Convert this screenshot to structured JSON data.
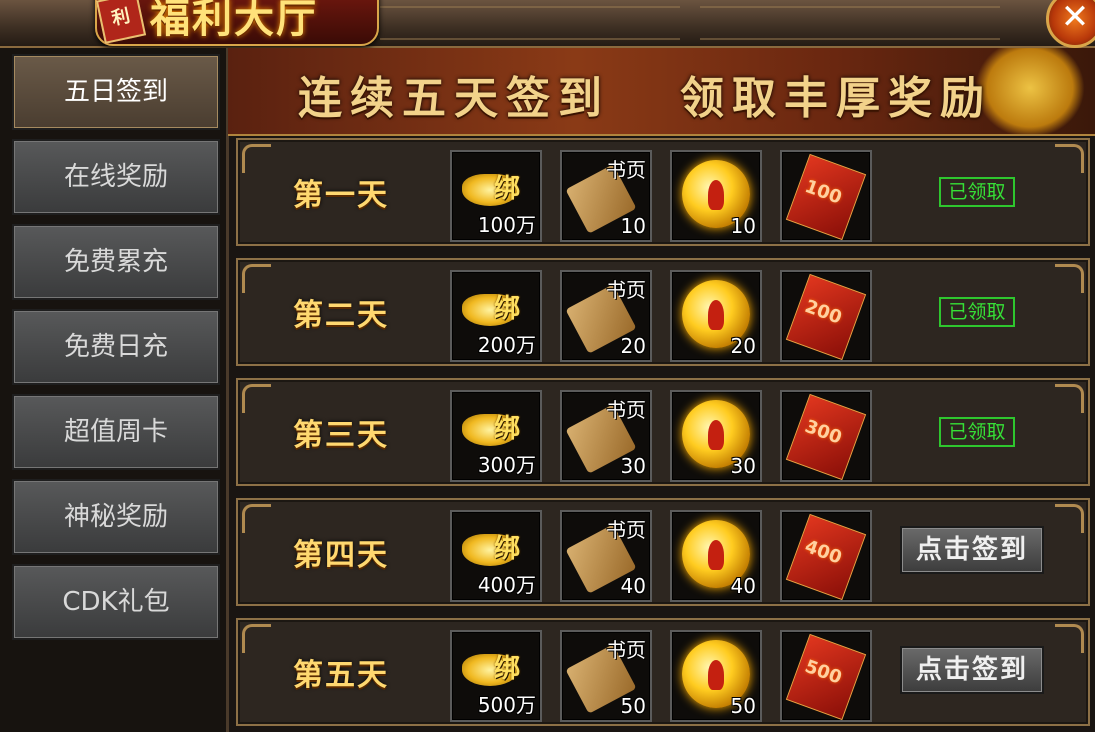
{
  "window": {
    "title": "福利大厅",
    "seal_text": "利",
    "close_glyph": "✕"
  },
  "sidebar": {
    "items": [
      {
        "label": "五日签到",
        "active": true
      },
      {
        "label": "在线奖励"
      },
      {
        "label": "免费累充"
      },
      {
        "label": "免费日充"
      },
      {
        "label": "超值周卡"
      },
      {
        "label": "神秘奖励"
      },
      {
        "label": "CDK礼包"
      }
    ]
  },
  "banner": {
    "left_text": "连续五天签到",
    "right_text": "领取丰厚奖励"
  },
  "item_labels": {
    "ingot_tag": "绑",
    "scroll_tag": "书页"
  },
  "days": [
    {
      "label": "第一天",
      "ingot": "100万",
      "pages": "10",
      "orb": "10",
      "envelope": "100",
      "status": "claimed",
      "status_text": "已领取"
    },
    {
      "label": "第二天",
      "ingot": "200万",
      "pages": "20",
      "orb": "20",
      "envelope": "200",
      "status": "claimed",
      "status_text": "已领取"
    },
    {
      "label": "第三天",
      "ingot": "300万",
      "pages": "30",
      "orb": "30",
      "envelope": "300",
      "status": "claimed",
      "status_text": "已领取"
    },
    {
      "label": "第四天",
      "ingot": "400万",
      "pages": "40",
      "orb": "40",
      "envelope": "400",
      "status": "signin",
      "status_text": "点击签到"
    },
    {
      "label": "第五天",
      "ingot": "500万",
      "pages": "50",
      "orb": "50",
      "envelope": "500",
      "status": "signin",
      "status_text": "点击签到"
    }
  ],
  "colors": {
    "claimed": "#36e036",
    "label_gold": "#ffd870"
  }
}
